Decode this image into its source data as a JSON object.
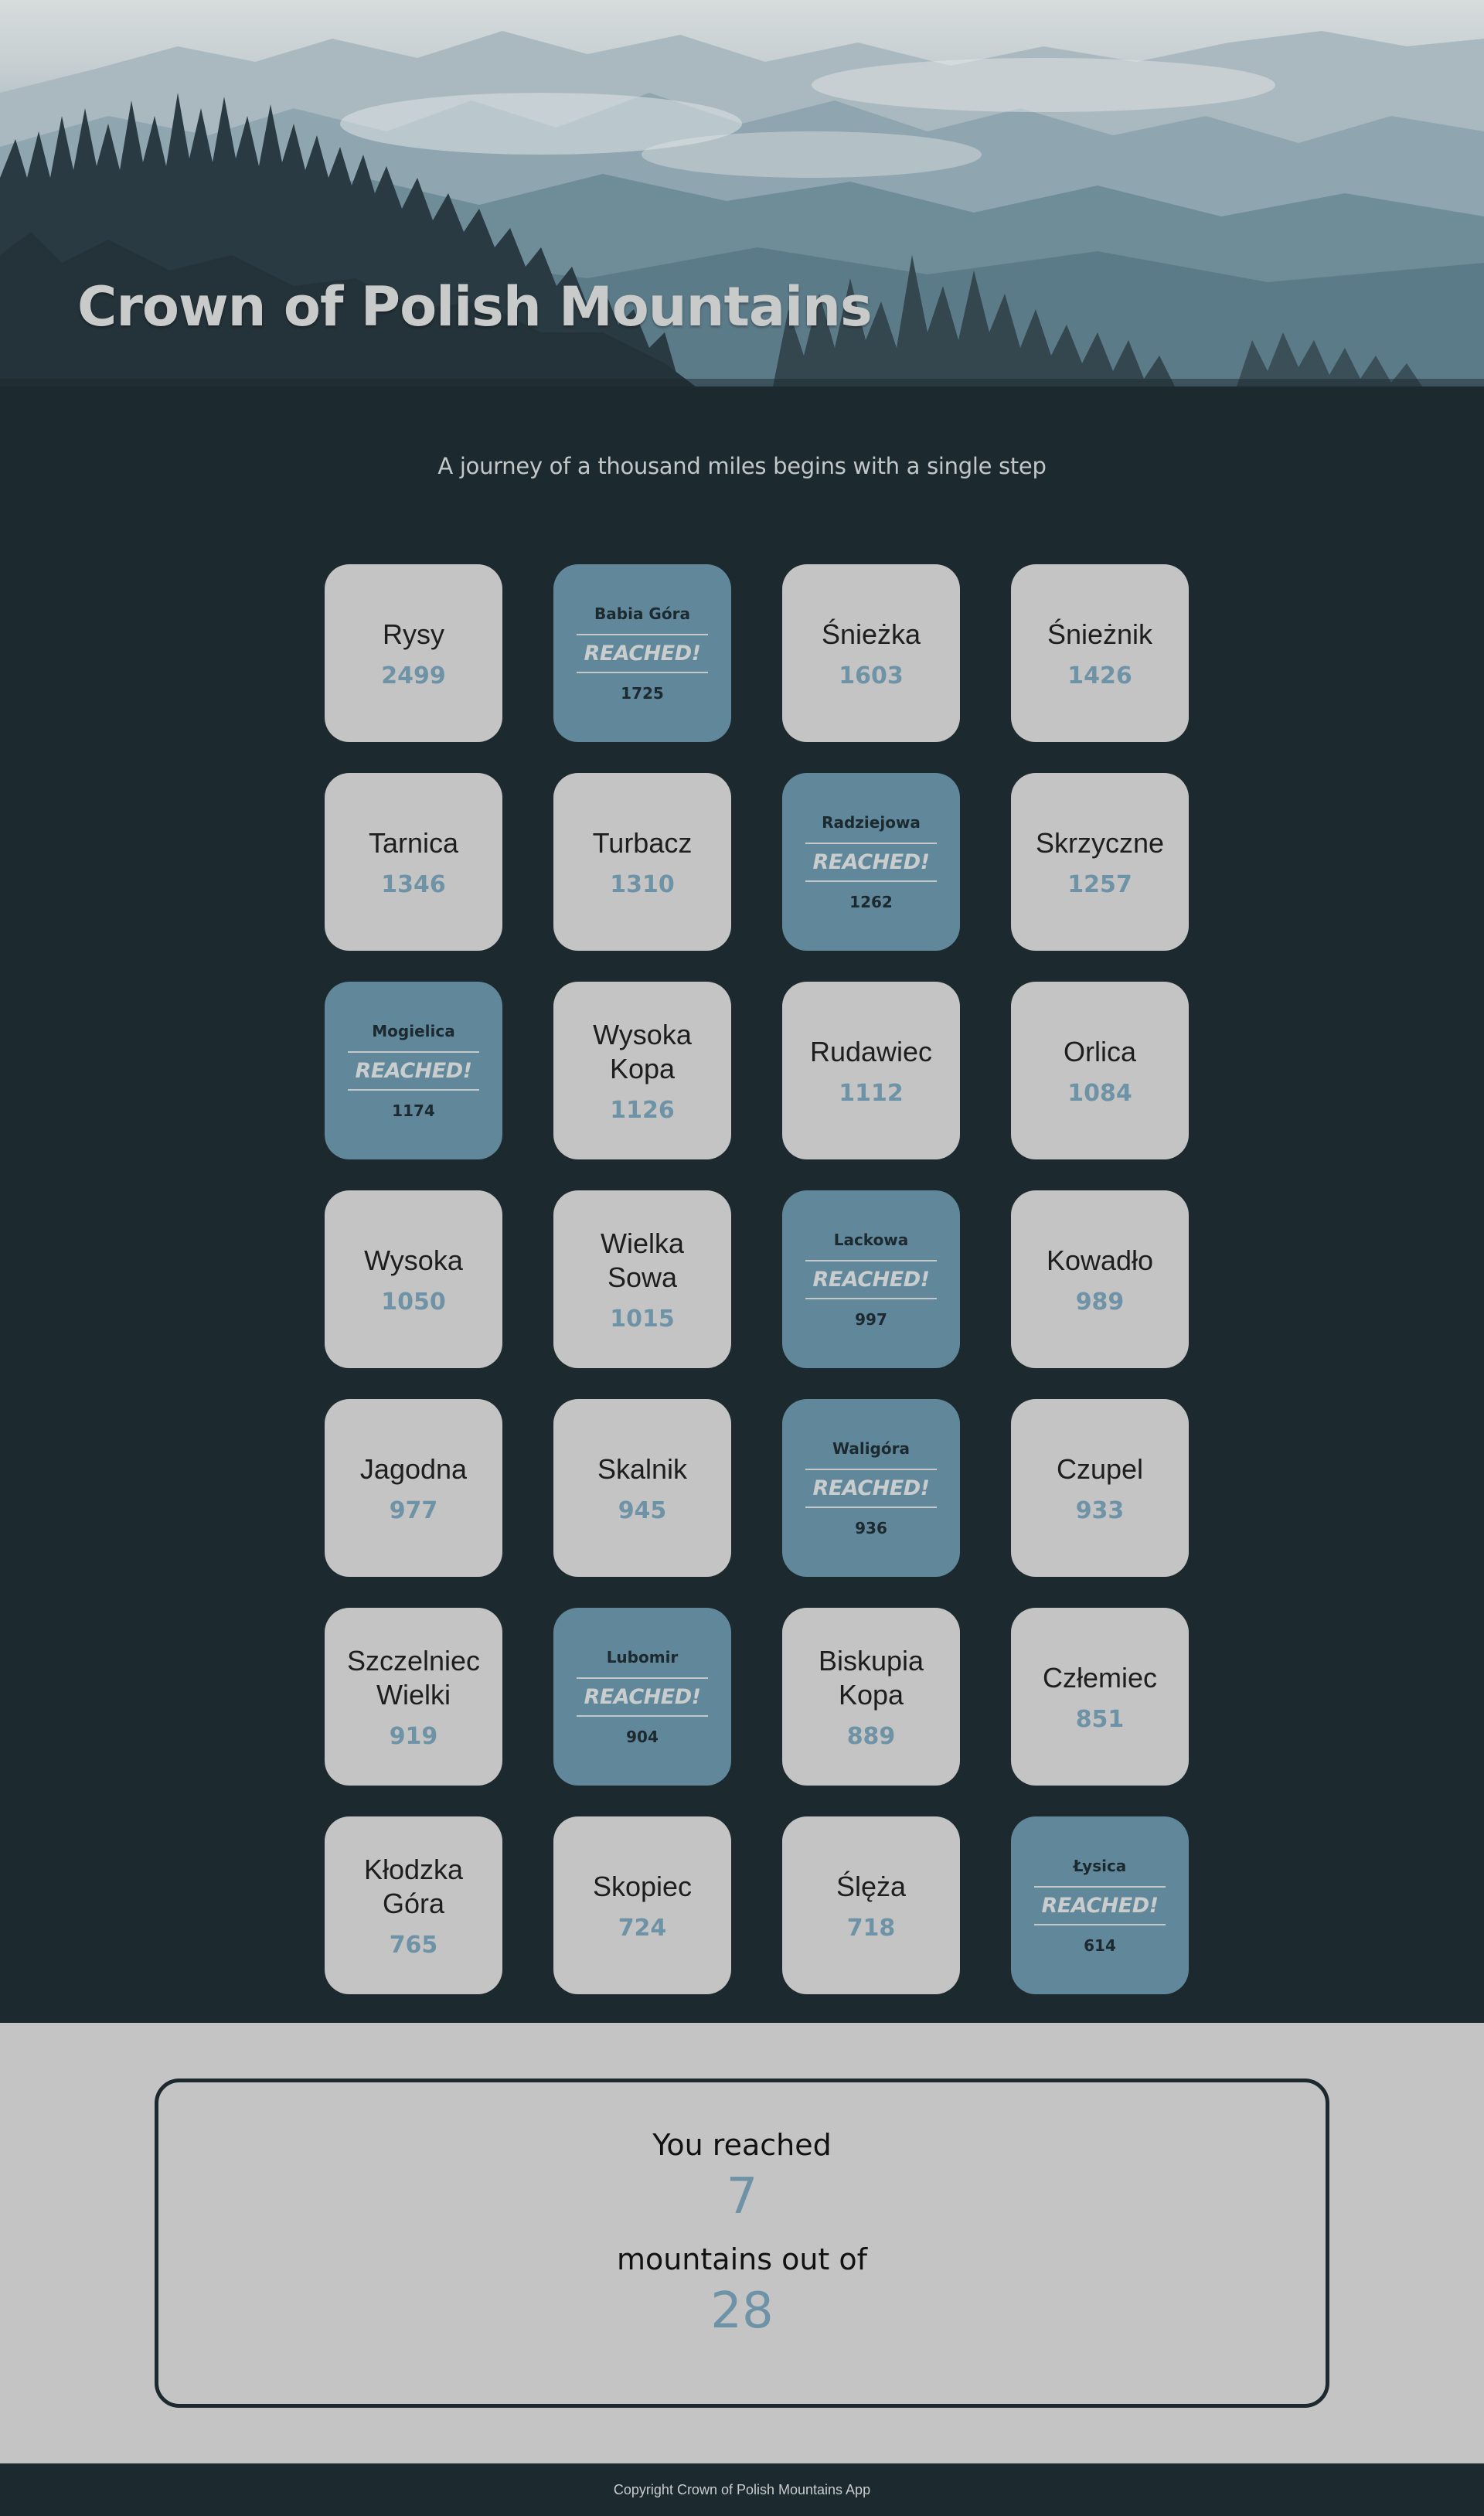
{
  "header": {
    "title": "Crown of Polish Mountains"
  },
  "main": {
    "tagline": "A journey of a thousand miles begins with a single step",
    "reached_label": "REACHED!",
    "mountains": [
      {
        "name": "Rysy",
        "height": "2499",
        "reached": false
      },
      {
        "name": "Babia Góra",
        "height": "1725",
        "reached": true
      },
      {
        "name": "Śnieżka",
        "height": "1603",
        "reached": false
      },
      {
        "name": "Śnieżnik",
        "height": "1426",
        "reached": false
      },
      {
        "name": "Tarnica",
        "height": "1346",
        "reached": false
      },
      {
        "name": "Turbacz",
        "height": "1310",
        "reached": false
      },
      {
        "name": "Radziejowa",
        "height": "1262",
        "reached": true
      },
      {
        "name": "Skrzyczne",
        "height": "1257",
        "reached": false
      },
      {
        "name": "Mogielica",
        "height": "1174",
        "reached": true
      },
      {
        "name": "Wysoka Kopa",
        "height": "1126",
        "reached": false
      },
      {
        "name": "Rudawiec",
        "height": "1112",
        "reached": false
      },
      {
        "name": "Orlica",
        "height": "1084",
        "reached": false
      },
      {
        "name": "Wysoka",
        "height": "1050",
        "reached": false
      },
      {
        "name": "Wielka Sowa",
        "height": "1015",
        "reached": false
      },
      {
        "name": "Lackowa",
        "height": "997",
        "reached": true
      },
      {
        "name": "Kowadło",
        "height": "989",
        "reached": false
      },
      {
        "name": "Jagodna",
        "height": "977",
        "reached": false
      },
      {
        "name": "Skalnik",
        "height": "945",
        "reached": false
      },
      {
        "name": "Waligóra",
        "height": "936",
        "reached": true
      },
      {
        "name": "Czupel",
        "height": "933",
        "reached": false
      },
      {
        "name": "Szczelniec Wielki",
        "height": "919",
        "reached": false
      },
      {
        "name": "Lubomir",
        "height": "904",
        "reached": true
      },
      {
        "name": "Biskupia Kopa",
        "height": "889",
        "reached": false
      },
      {
        "name": "Człemiec",
        "height": "851",
        "reached": false
      },
      {
        "name": "Kłodzka Góra",
        "height": "765",
        "reached": false
      },
      {
        "name": "Skopiec",
        "height": "724",
        "reached": false
      },
      {
        "name": "Ślęża",
        "height": "718",
        "reached": false
      },
      {
        "name": "Łysica",
        "height": "614",
        "reached": true
      }
    ]
  },
  "summary": {
    "line1": "You reached",
    "reached_count": "7",
    "line2": "mountains out of",
    "total_count": "28"
  },
  "footer": {
    "copyright": "Copyright Crown of Polish Mountains App"
  },
  "colors": {
    "background_dark": "#1c2a30",
    "card_grey": "#c4c4c4",
    "card_reached": "#60879a",
    "accent_blue": "#6e93a6"
  }
}
